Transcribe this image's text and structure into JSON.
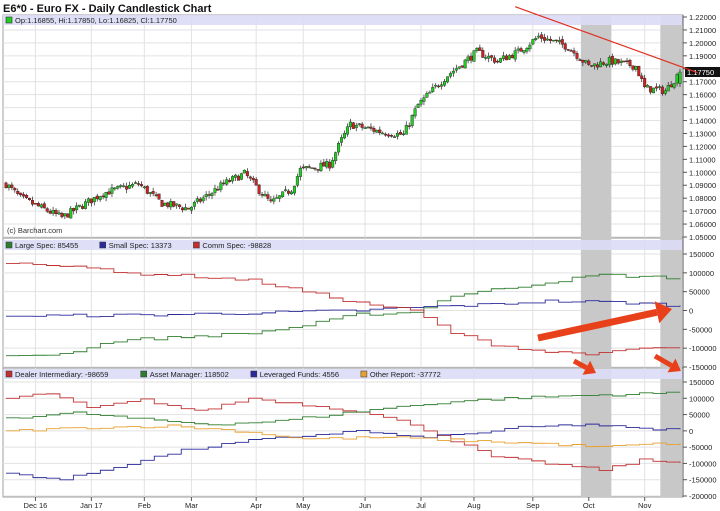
{
  "title": "E6*0 - Euro FX - Daily Candlestick Chart",
  "ohlc_label": "Op:1.16855, Hi:1.17850, Lo:1.16825, Cl:1.17750",
  "last_price_label": "1.17750",
  "watermark": "(c) Barchart.com",
  "colors": {
    "up": "#22cc22",
    "down": "#cc2222",
    "band": "#dcdcf6",
    "shade": "#c8c8c8",
    "trend": "#e03020",
    "arrow": "#e8401a"
  },
  "chart_data": [
    {
      "type": "candlestick",
      "title": "Euro FX Daily",
      "ylim": [
        1.05,
        1.22
      ],
      "yticks": [
        "1.22000",
        "1.21000",
        "1.20000",
        "1.19000",
        "1.18000",
        "1.17000",
        "1.16000",
        "1.15000",
        "1.14000",
        "1.13000",
        "1.12000",
        "1.11000",
        "1.10000",
        "1.09000",
        "1.08000",
        "1.07000",
        "1.06000",
        "1.05000"
      ],
      "xticks": [
        "Dec 16",
        "Jan 17",
        "Feb",
        "Mar",
        "Apr",
        "May",
        "Jun",
        "Jul",
        "Aug",
        "Sep",
        "Oct",
        "Nov"
      ],
      "xtick_days": [
        10,
        29,
        47,
        63,
        85,
        101,
        122,
        141,
        159,
        179,
        198,
        217
      ],
      "days": 230,
      "close_keypoints": [
        [
          0,
          1.091
        ],
        [
          5,
          1.08
        ],
        [
          19,
          1.065
        ],
        [
          33,
          1.084
        ],
        [
          45,
          1.091
        ],
        [
          53,
          1.076
        ],
        [
          62,
          1.072
        ],
        [
          74,
          1.091
        ],
        [
          81,
          1.099
        ],
        [
          90,
          1.076
        ],
        [
          97,
          1.087
        ],
        [
          100,
          1.102
        ],
        [
          110,
          1.106
        ],
        [
          114,
          1.125
        ],
        [
          117,
          1.137
        ],
        [
          128,
          1.131
        ],
        [
          135,
          1.129
        ],
        [
          140,
          1.152
        ],
        [
          150,
          1.175
        ],
        [
          160,
          1.193
        ],
        [
          167,
          1.186
        ],
        [
          174,
          1.193
        ],
        [
          181,
          1.205
        ],
        [
          191,
          1.197
        ],
        [
          198,
          1.182
        ],
        [
          205,
          1.186
        ],
        [
          214,
          1.182
        ],
        [
          217,
          1.165
        ],
        [
          224,
          1.163
        ],
        [
          229,
          1.1775
        ]
      ],
      "shaded_day_ranges": [
        [
          196,
          205
        ],
        [
          223,
          229
        ]
      ],
      "trendline": [
        [
          173,
          1.228
        ],
        [
          235,
          1.177
        ]
      ]
    },
    {
      "type": "line",
      "title": "COT Legacy",
      "ylim": [
        -150000,
        150000
      ],
      "yticks": [
        "150000",
        "100000",
        "50000",
        "0",
        "-50000",
        "-100000",
        "-150000"
      ],
      "series": [
        {
          "name": "Large Spec",
          "legend": "Large Spec: 85455",
          "color": "#2e7d2e",
          "keypoints": [
            [
              0,
              -120000
            ],
            [
              4,
              -115000
            ],
            [
              8,
              -80000
            ],
            [
              13,
              -70000
            ],
            [
              18,
              -60000
            ],
            [
              22,
              -40000
            ],
            [
              26,
              -10000
            ],
            [
              30,
              -5000
            ],
            [
              33,
              40000
            ],
            [
              37,
              60000
            ],
            [
              40,
              75000
            ],
            [
              44,
              95000
            ],
            [
              47,
              90000
            ],
            [
              50,
              85455
            ]
          ]
        },
        {
          "name": "Small Spec",
          "legend": "Small Spec: 13373",
          "color": "#2a2a9a",
          "keypoints": [
            [
              0,
              -15000
            ],
            [
              10,
              -12000
            ],
            [
              20,
              -5000
            ],
            [
              26,
              0
            ],
            [
              30,
              8000
            ],
            [
              35,
              15000
            ],
            [
              40,
              25000
            ],
            [
              45,
              22000
            ],
            [
              50,
              13373
            ]
          ]
        },
        {
          "name": "Comm Spec",
          "legend": "Comm Spec: -98828",
          "color": "#c03030",
          "keypoints": [
            [
              0,
              125000
            ],
            [
              5,
              120000
            ],
            [
              8,
              100000
            ],
            [
              12,
              95000
            ],
            [
              18,
              80000
            ],
            [
              22,
              50000
            ],
            [
              26,
              20000
            ],
            [
              30,
              0
            ],
            [
              33,
              -60000
            ],
            [
              36,
              -90000
            ],
            [
              40,
              -110000
            ],
            [
              44,
              -115000
            ],
            [
              47,
              -100000
            ],
            [
              50,
              -98828
            ]
          ]
        }
      ]
    },
    {
      "type": "line",
      "title": "COT Financial",
      "ylim": [
        -200000,
        150000
      ],
      "yticks": [
        "150000",
        "100000",
        "50000",
        "0",
        "-50000",
        "-100000",
        "-150000",
        "-200000"
      ],
      "series": [
        {
          "name": "Dealer Intermediary",
          "legend": "Dealer Intermediary: -98659",
          "color": "#c03030",
          "keypoints": [
            [
              0,
              100000
            ],
            [
              3,
              115000
            ],
            [
              6,
              70000
            ],
            [
              10,
              95000
            ],
            [
              14,
              60000
            ],
            [
              18,
              100000
            ],
            [
              22,
              80000
            ],
            [
              26,
              60000
            ],
            [
              30,
              20000
            ],
            [
              33,
              -30000
            ],
            [
              36,
              -80000
            ],
            [
              40,
              -100000
            ],
            [
              44,
              -120000
            ],
            [
              47,
              -90000
            ],
            [
              50,
              -98659
            ]
          ]
        },
        {
          "name": "Asset Manager",
          "legend": "Asset Manager: 118502",
          "color": "#2e7d2e",
          "keypoints": [
            [
              0,
              40000
            ],
            [
              5,
              55000
            ],
            [
              10,
              35000
            ],
            [
              15,
              20000
            ],
            [
              20,
              30000
            ],
            [
              24,
              50000
            ],
            [
              28,
              70000
            ],
            [
              33,
              90000
            ],
            [
              37,
              100000
            ],
            [
              42,
              108000
            ],
            [
              46,
              112000
            ],
            [
              50,
              118502
            ]
          ]
        },
        {
          "name": "Leveraged Funds",
          "legend": "Leveraged Funds: 4556",
          "color": "#2a2a9a",
          "keypoints": [
            [
              0,
              -130000
            ],
            [
              4,
              -150000
            ],
            [
              8,
              -110000
            ],
            [
              13,
              -60000
            ],
            [
              18,
              -30000
            ],
            [
              22,
              -15000
            ],
            [
              26,
              0
            ],
            [
              30,
              -20000
            ],
            [
              34,
              -10000
            ],
            [
              38,
              10000
            ],
            [
              43,
              20000
            ],
            [
              47,
              5000
            ],
            [
              50,
              4556
            ]
          ]
        },
        {
          "name": "Other Report",
          "legend": "Other Report: -37772",
          "color": "#e8a030",
          "keypoints": [
            [
              0,
              0
            ],
            [
              6,
              10000
            ],
            [
              12,
              15000
            ],
            [
              17,
              0
            ],
            [
              22,
              -25000
            ],
            [
              28,
              -20000
            ],
            [
              34,
              -30000
            ],
            [
              40,
              -40000
            ],
            [
              44,
              -50000
            ],
            [
              47,
              -42000
            ],
            [
              50,
              -37772
            ]
          ]
        }
      ]
    }
  ]
}
